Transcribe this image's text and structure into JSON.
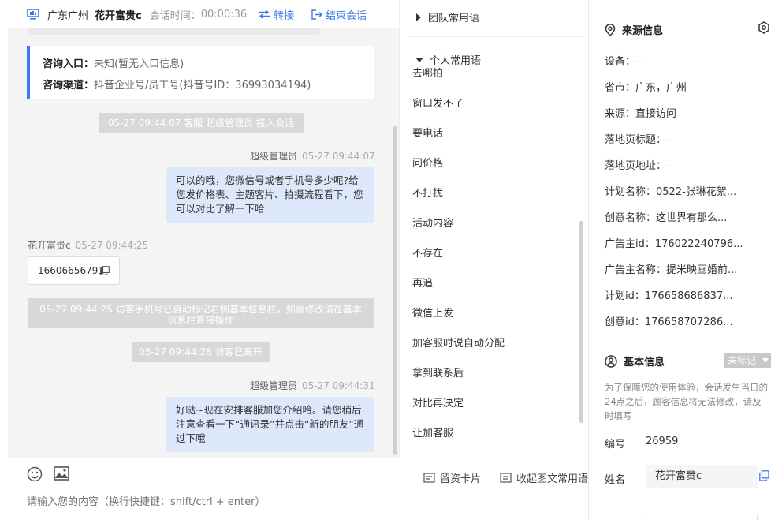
{
  "header": {
    "location": "广东广州",
    "visitor_name": "花开富贵c",
    "time_label": "会话时间：",
    "time_value": "00:00:36",
    "transfer_label": "转接",
    "end_label": "结束会话"
  },
  "source_card": {
    "entry_label": "咨询入口：",
    "entry_value": "未知(暂无入口信息)",
    "channel_label": "咨询渠道：",
    "channel_value": "抖音企业号/员工号(抖音号ID：36993034194)"
  },
  "messages": {
    "sys_join": "05-27 09:44:07 客服 超级管理员 接入会话",
    "agent_meta_1_name": "超级管理员",
    "agent_meta_1_time": "05-27 09:44:07",
    "agent_msg_1": "可以的哦，您微信号或者手机号多少呢?给您发价格表、主题客片、拍摄流程看下，您可以对比了解一下哈",
    "visitor_meta_name": "花开富贵c",
    "visitor_meta_time": "05-27 09:44:25",
    "visitor_phone": "16606656791",
    "sys_phone": "05-27 09:44:25 访客手机号已自动标记右侧基本信息栏，如需修改请在基本信息栏直接操作",
    "sys_left": "05-27 09:44:28 访客已离开",
    "agent_meta_2_name": "超级管理员",
    "agent_meta_2_time": "05-27 09:44:31",
    "agent_msg_2": "好哒~现在安排客服加您介绍哈。请您稍后注意查看一下“通讯录”并点击“新的朋友”通过下哦"
  },
  "composer": {
    "card_label": "留资卡片",
    "collapse_label": "收起图文常用语",
    "placeholder": "请输入您的内容（换行快捷键：shift/ctrl + enter）"
  },
  "phrases": {
    "team_group": "团队常用语",
    "personal_group": "个人常用语",
    "items": [
      "去哪拍",
      "窗口发不了",
      "要电话",
      "问价格",
      "不打扰",
      "活动内容",
      "不存在",
      "再追",
      "微信上发",
      "加客服时说自动分配",
      "拿到联系后",
      "对比再决定",
      "让加客服"
    ]
  },
  "info": {
    "source_title": "来源信息",
    "rows": [
      "设备：--",
      "省市：广东，广州",
      "来源：直接访问",
      "落地页标题：--",
      "落地页地址：--",
      "计划名称：0522-张琳花絮...",
      "创意名称：这世界有那么...",
      "广告主id：176022240796...",
      "广告主名称：提米映画婚前...",
      "计划id：176658686837...",
      "创意id：176658707286..."
    ],
    "basic_title": "基本信息",
    "tag_label": "未标记",
    "note": "为了保障您的使用体验，会话发生当日的24点之后，顾客信息将无法修改，请及时填写",
    "id_label": "编号",
    "id_value": "26959",
    "name_label": "姓名",
    "name_value": "花开富贵c"
  },
  "colors": {
    "accent": "#3b7ae8",
    "agent_bubble": "#dde8fb",
    "system_bar": "#d8d8d8",
    "tag": "#c8c8c8"
  }
}
